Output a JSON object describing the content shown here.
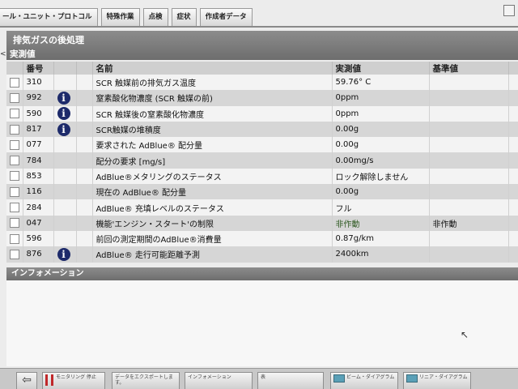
{
  "tabs": [
    "ール・ユニット・プロトコル",
    "特殊作業",
    "点検",
    "症状",
    "作成者データ"
  ],
  "section_title": "排気ガスの後処理",
  "subsection_title": "実測値",
  "columns": {
    "number": "番号",
    "name": "名前",
    "actual": "実測値",
    "reference": "基準値"
  },
  "rows": [
    {
      "number": "310",
      "info": false,
      "name": "SCR 触媒前の排気ガス温度",
      "actual": "59.76° C",
      "reference": ""
    },
    {
      "number": "992",
      "info": true,
      "name": "窒素酸化物濃度 (SCR 触媒の前)",
      "actual": "0ppm",
      "reference": ""
    },
    {
      "number": "590",
      "info": true,
      "name": "SCR 触媒後の窒素酸化物濃度",
      "actual": "0ppm",
      "reference": ""
    },
    {
      "number": "817",
      "info": true,
      "name": "SCR触媒の堆積度",
      "actual": "0.00g",
      "reference": ""
    },
    {
      "number": "077",
      "info": false,
      "name": "要求された AdBlue® 配分量",
      "actual": "0.00g",
      "reference": ""
    },
    {
      "number": "784",
      "info": false,
      "name": "配分の要求 [mg/s]",
      "actual": "0.00mg/s",
      "reference": ""
    },
    {
      "number": "853",
      "info": false,
      "name": "AdBlue®メタリングのステータス",
      "actual": "ロック解除しません",
      "reference": ""
    },
    {
      "number": "116",
      "info": false,
      "name": "現在の AdBlue® 配分量",
      "actual": "0.00g",
      "reference": ""
    },
    {
      "number": "284",
      "info": false,
      "name": "AdBlue® 充填レベルのステータス",
      "actual": "フル",
      "reference": ""
    },
    {
      "number": "047",
      "info": false,
      "name": "機能'エンジン・スタート'の制限",
      "actual": "非作動",
      "reference": "非作動",
      "actual_color": "#2f5a22"
    },
    {
      "number": "596",
      "info": false,
      "name": "前回の測定期間のAdBlue®消費量",
      "actual": "0.87g/km",
      "reference": ""
    },
    {
      "number": "876",
      "info": true,
      "name": "AdBlue® 走行可能距離予測",
      "actual": "2400km",
      "reference": ""
    }
  ],
  "info_section_title": "インフォメーション",
  "bottom_buttons": {
    "monitoring": "モニタリング 停止",
    "export": "データをエクスポートします。",
    "information": "インフォメーション",
    "table": "表",
    "beam": "ビーム・ダイアグラム",
    "linear": "リニア・ダイアグラム"
  },
  "info_icon_glyph": "i"
}
